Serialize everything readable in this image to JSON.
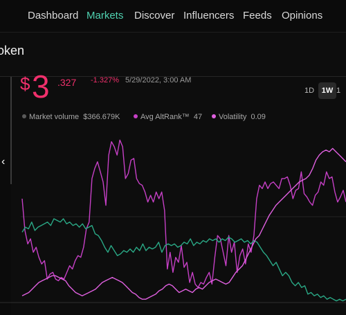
{
  "nav": {
    "items": [
      {
        "label": "Dashboard",
        "active": false
      },
      {
        "label": "Markets",
        "active": true
      },
      {
        "label": "Discover",
        "active": false
      },
      {
        "label": "Influencers",
        "active": false
      },
      {
        "label": "Feeds",
        "active": false
      },
      {
        "label": "Opinions",
        "active": false
      }
    ]
  },
  "page": {
    "title": "oken"
  },
  "price": {
    "symbol": "$",
    "integer": "3",
    "decimal": ".327",
    "change": "-1.327%",
    "datetime": "5/29/2022, 3:00 AM"
  },
  "ranges": [
    {
      "label": "1D",
      "active": false
    },
    {
      "label": "1W",
      "active": true
    },
    {
      "label": "1",
      "active": false
    }
  ],
  "legend": {
    "market_volume_label": "Market volume",
    "market_volume_value": "$366.679K",
    "altrank_label": "Avg AltRank™",
    "altrank_value": "47",
    "volatility_label": "Volatility",
    "volatility_value": "0.09"
  },
  "colors": {
    "accent_green": "#4fd1b0",
    "negative_red": "#f0306c",
    "altrank_magenta": "#c640c6",
    "volatility_pink": "#e060e0",
    "green_series": "#2aa986",
    "market_volume_dot": "#5a5a5a"
  },
  "icons": {
    "collapse": "chevron-left-icon"
  },
  "chart_data": {
    "type": "line",
    "title": "",
    "xlabel": "",
    "ylabel": "",
    "grid": false,
    "series": [
      {
        "name": "Avg AltRank™",
        "color": "#c640c6",
        "values": [
          0.62,
          0.43,
          0.35,
          0.38,
          0.3,
          0.33,
          0.27,
          0.23,
          0.25,
          0.14,
          0.17,
          0.18,
          0.14,
          0.13,
          0.15,
          0.14,
          0.18,
          0.22,
          0.2,
          0.25,
          0.28,
          0.27,
          0.33,
          0.44,
          0.48,
          0.74,
          0.8,
          0.84,
          0.78,
          0.72,
          0.58,
          0.88,
          0.96,
          0.93,
          0.88,
          0.97,
          0.93,
          0.74,
          0.77,
          0.85,
          0.86,
          0.74,
          0.71,
          0.7,
          0.66,
          0.6,
          0.64,
          0.6,
          0.66,
          0.62,
          0.66,
          0.55,
          0.2,
          0.3,
          0.18,
          0.27,
          0.24,
          0.34,
          0.21,
          0.24,
          0.12,
          0.18,
          0.11,
          0.09,
          0.12,
          0.11,
          0.15,
          0.18,
          0.11,
          0.27,
          0.4,
          0.38,
          0.3,
          0.22,
          0.4,
          0.3,
          0.36,
          0.18,
          0.28,
          0.32,
          0.23,
          0.35,
          0.3,
          0.4,
          0.62,
          0.7,
          0.68,
          0.72,
          0.68,
          0.71,
          0.72,
          0.7,
          0.68,
          0.74,
          0.74,
          0.75,
          0.7,
          0.62,
          0.67,
          0.68,
          0.78,
          0.65,
          0.63,
          0.6,
          0.58,
          0.64,
          0.66,
          0.72,
          0.7,
          0.78,
          0.74,
          0.75,
          0.66,
          0.6,
          0.63,
          0.67,
          0.6
        ]
      },
      {
        "name": "Market volume",
        "color": "#2aa986",
        "values": [
          0.42,
          0.45,
          0.44,
          0.48,
          0.43,
          0.45,
          0.46,
          0.47,
          0.48,
          0.46,
          0.5,
          0.49,
          0.48,
          0.5,
          0.47,
          0.48,
          0.46,
          0.47,
          0.45,
          0.47,
          0.44,
          0.45,
          0.46,
          0.41,
          0.4,
          0.37,
          0.33,
          0.3,
          0.34,
          0.31,
          0.28,
          0.29,
          0.31,
          0.3,
          0.32,
          0.3,
          0.33,
          0.31,
          0.35,
          0.31,
          0.33,
          0.32,
          0.33,
          0.36,
          0.3,
          0.34,
          0.35,
          0.34,
          0.35,
          0.33,
          0.34,
          0.36,
          0.35,
          0.38,
          0.34,
          0.36,
          0.35,
          0.37,
          0.36,
          0.38,
          0.37,
          0.38,
          0.36,
          0.38,
          0.37,
          0.39,
          0.38,
          0.36,
          0.37,
          0.38,
          0.36,
          0.37,
          0.35,
          0.37,
          0.36,
          0.33,
          0.3,
          0.28,
          0.25,
          0.22,
          0.24,
          0.2,
          0.16,
          0.18,
          0.16,
          0.12,
          0.1,
          0.12,
          0.09,
          0.1,
          0.05,
          0.06,
          0.04,
          0.05,
          0.03,
          0.04,
          0.02,
          0.03,
          0.02,
          0.01,
          0.02,
          0.01,
          0.02
        ]
      },
      {
        "name": "Volatility",
        "color": "#e060e0",
        "values": [
          0.04,
          0.05,
          0.06,
          0.08,
          0.1,
          0.12,
          0.13,
          0.14,
          0.15,
          0.16,
          0.16,
          0.15,
          0.14,
          0.13,
          0.1,
          0.08,
          0.06,
          0.05,
          0.04,
          0.05,
          0.06,
          0.07,
          0.08,
          0.1,
          0.12,
          0.13,
          0.14,
          0.15,
          0.14,
          0.13,
          0.12,
          0.1,
          0.08,
          0.06,
          0.05,
          0.03,
          0.02,
          0.02,
          0.03,
          0.04,
          0.05,
          0.07,
          0.08,
          0.1,
          0.11,
          0.1,
          0.08,
          0.06,
          0.07,
          0.08,
          0.07,
          0.06,
          0.08,
          0.09,
          0.08,
          0.1,
          0.12,
          0.13,
          0.14,
          0.13,
          0.12,
          0.11,
          0.12,
          0.15,
          0.18,
          0.2,
          0.22,
          0.26,
          0.3,
          0.34,
          0.38,
          0.4,
          0.44,
          0.48,
          0.52,
          0.55,
          0.58,
          0.6,
          0.62,
          0.64,
          0.66,
          0.68,
          0.7,
          0.72,
          0.73,
          0.74,
          0.76,
          0.8,
          0.85,
          0.88,
          0.9,
          0.91,
          0.9,
          0.92,
          0.9,
          0.88,
          0.86,
          0.84
        ]
      }
    ]
  }
}
